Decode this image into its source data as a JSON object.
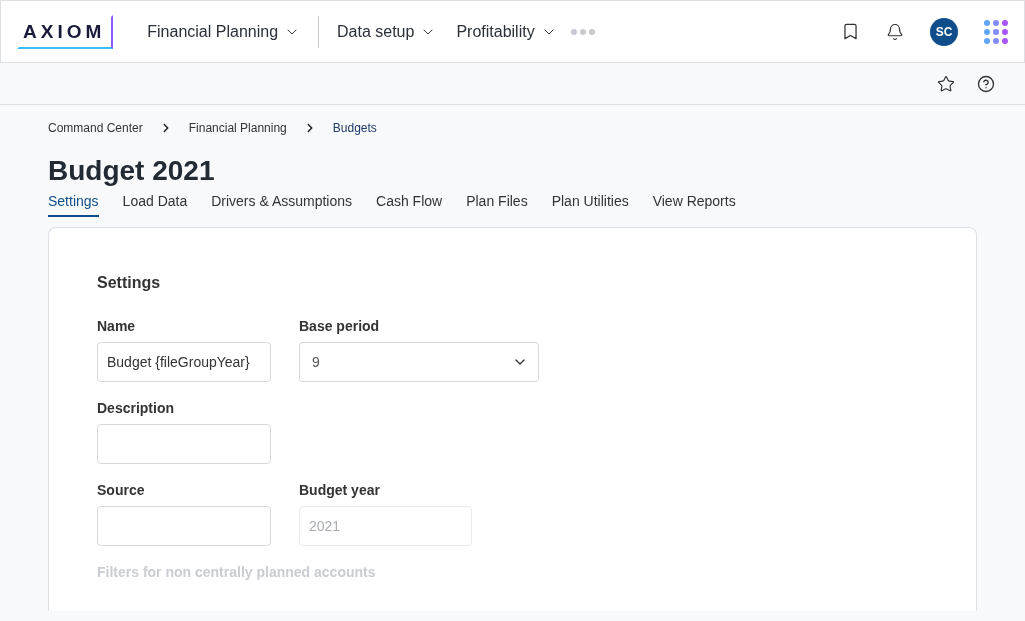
{
  "header": {
    "logo": "AXIOM",
    "nav": [
      {
        "label": "Financial Planning"
      },
      {
        "label": "Data setup"
      },
      {
        "label": "Profitability"
      }
    ],
    "avatar": "SC"
  },
  "breadcrumb": [
    "Command Center",
    "Financial Planning",
    "Budgets"
  ],
  "page_title": "Budget 2021",
  "tabs": [
    {
      "label": "Settings",
      "selected": true
    },
    {
      "label": "Load Data",
      "selected": false
    },
    {
      "label": "Drivers & Assumptions",
      "selected": false
    },
    {
      "label": "Cash Flow",
      "selected": false
    },
    {
      "label": "Plan Files",
      "selected": false
    },
    {
      "label": "Plan Utilities",
      "selected": false
    },
    {
      "label": "View Reports",
      "selected": false
    }
  ],
  "settings": {
    "heading": "Settings",
    "rows": [
      [
        {
          "label": "Name",
          "kind": "text",
          "value": "Budget {fileGroupYear}"
        },
        {
          "label": "Base period",
          "kind": "select",
          "value": "9"
        }
      ],
      [
        {
          "label": "Description",
          "kind": "text"
        }
      ],
      [
        {
          "label": "Source",
          "kind": "text"
        },
        {
          "label": "Budget year",
          "kind": "text",
          "value": "2021",
          "disabled": true
        }
      ]
    ],
    "footer_label": "Filters for non centrally planned accounts"
  }
}
